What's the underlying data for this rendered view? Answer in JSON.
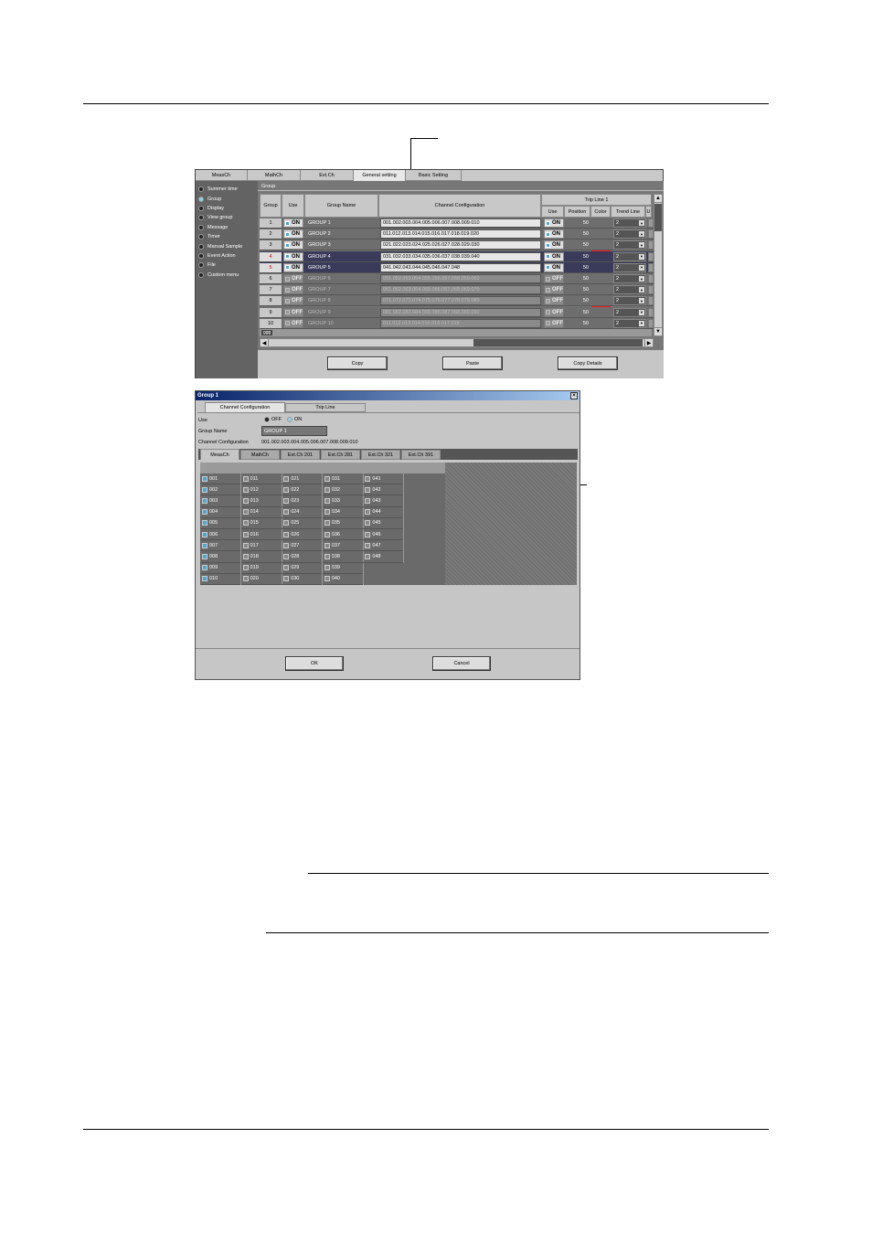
{
  "main_window": {
    "tabs": [
      "MeasCh",
      "MathCh",
      "Ext.Ch",
      "General setting",
      "Basic Setting"
    ],
    "active_tab": "General setting",
    "sidebar": [
      "Summer time",
      "Group",
      "Display",
      "View group",
      "Message",
      "Timer",
      "Manual Sample",
      "Event Action",
      "File",
      "Custom menu"
    ],
    "selected_sidebar": "Group",
    "section_title": "Group",
    "table": {
      "headers": {
        "group": "Group",
        "use": "Use",
        "name": "Group Name",
        "config": "Channel Configuration",
        "tripline": "Trip Line 1",
        "tl_use": "Use",
        "tl_position": "Position",
        "tl_color": "Color",
        "tl_trend": "Trend Line",
        "tl_more": "U"
      },
      "rows": [
        {
          "num": "1",
          "use": "ON",
          "name": "GROUP 1",
          "config": "001.002.003.004.005.006.007.008.009.010",
          "tl_use": "ON",
          "position": "50",
          "trend": "2"
        },
        {
          "num": "2",
          "use": "ON",
          "name": "GROUP 2",
          "config": "011.012.013.014.015.016.017.018.019.020",
          "tl_use": "ON",
          "position": "50",
          "trend": "2"
        },
        {
          "num": "3",
          "use": "ON",
          "name": "GROUP 3",
          "config": "021.022.023.024.025.026.027.028.029.030",
          "tl_use": "ON",
          "position": "50",
          "trend": "2"
        },
        {
          "num": "4",
          "use": "ON",
          "name": "GROUP 4",
          "config": "031.032.033.034.035.036.037.038.039.040",
          "tl_use": "ON",
          "position": "50",
          "trend": "2"
        },
        {
          "num": "5",
          "use": "ON",
          "name": "GROUP 5",
          "config": "041.042.043.044.045.046.047.048",
          "tl_use": "ON",
          "position": "50",
          "trend": "2"
        },
        {
          "num": "6",
          "use": "OFF",
          "name": "GROUP 6",
          "config": "051.052.053.054.055.056.057.058.059.060",
          "tl_use": "OFF",
          "position": "50",
          "trend": "2"
        },
        {
          "num": "7",
          "use": "OFF",
          "name": "GROUP 7",
          "config": "061.062.063.064.065.066.067.068.069.070",
          "tl_use": "OFF",
          "position": "50",
          "trend": "2"
        },
        {
          "num": "8",
          "use": "OFF",
          "name": "GROUP 8",
          "config": "071.072.073.074.075.076.077.078.079.080",
          "tl_use": "OFF",
          "position": "50",
          "trend": "2"
        },
        {
          "num": "9",
          "use": "OFF",
          "name": "GROUP 9",
          "config": "081.082.083.084.085.086.087.088.089.090",
          "tl_use": "OFF",
          "position": "50",
          "trend": "2"
        },
        {
          "num": "10",
          "use": "OFF",
          "name": "GROUP 10",
          "config": "011.012.013.014.015.016.017.018",
          "tl_use": "OFF",
          "position": "50",
          "trend": "2"
        }
      ],
      "footer_label": "ggg"
    },
    "buttons": {
      "copy": "Copy",
      "paste": "Paste",
      "copy_details": "Copy Details"
    }
  },
  "dialog": {
    "title": "Group 1",
    "close": "×",
    "tabs": [
      "Channel Configuration",
      "Trip Line"
    ],
    "use_label": "Use",
    "use_off": "OFF",
    "use_on": "ON",
    "group_name_label": "Group Name",
    "group_name_value": "GROUP 1",
    "channel_config_label": "Channel Configuration",
    "channel_config_value": "001.002.003.004.005.006.007.008.009.010",
    "channel_tabs": [
      "MeasCh",
      "MathCh",
      "Ext.Ch 201",
      "Ext.Ch 281",
      "Ext.Ch 321",
      "Ext.Ch 391"
    ],
    "channel_columns": [
      [
        "001",
        "002",
        "003",
        "004",
        "005",
        "006",
        "007",
        "008",
        "009",
        "010"
      ],
      [
        "011",
        "012",
        "013",
        "014",
        "015",
        "016",
        "017",
        "018",
        "019",
        "020"
      ],
      [
        "021",
        "022",
        "023",
        "024",
        "025",
        "026",
        "027",
        "028",
        "029",
        "030"
      ],
      [
        "031",
        "032",
        "033",
        "034",
        "035",
        "036",
        "037",
        "038",
        "039",
        "040"
      ],
      [
        "041",
        "042",
        "043",
        "044",
        "045",
        "046",
        "047",
        "048"
      ]
    ],
    "buttons": {
      "ok": "OK",
      "cancel": "Cancel"
    }
  }
}
